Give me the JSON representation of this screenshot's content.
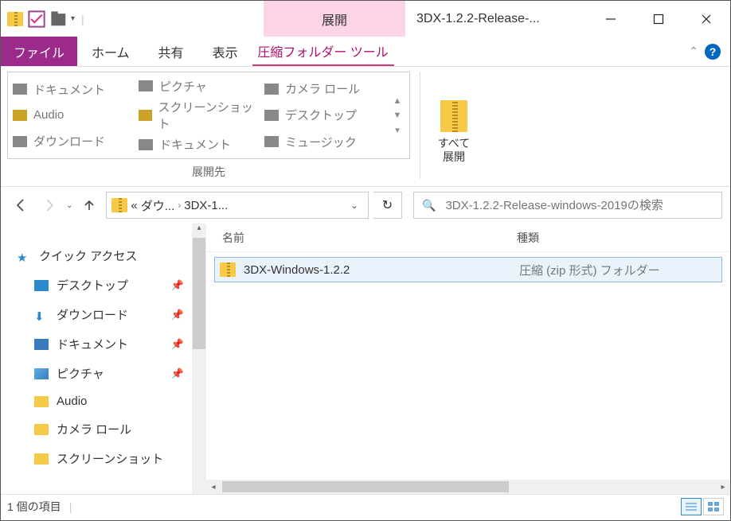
{
  "titlebar": {
    "context_label": "展開",
    "window_title": "3DX-1.2.2-Release-..."
  },
  "tabs": {
    "file": "ファイル",
    "home": "ホーム",
    "share": "共有",
    "view": "表示",
    "compressed": "圧縮フォルダー ツール"
  },
  "ribbon": {
    "destinations": [
      [
        "ドキュメント",
        "Audio",
        "ダウンロード"
      ],
      [
        "ピクチャ",
        "スクリーンショット",
        "ドキュメント"
      ],
      [
        "カメラ ロール",
        "デスクトップ",
        "ミュージック"
      ]
    ],
    "group_label": "展開先",
    "extract_all": "すべて\n展開"
  },
  "breadcrumbs": {
    "prefix": "«",
    "c1": "ダウ...",
    "c2": "3DX-1..."
  },
  "search": {
    "placeholder": "3DX-1.2.2-Release-windows-2019の検索"
  },
  "sidebar": {
    "quick": "クイック アクセス",
    "items": [
      {
        "label": "デスクトップ",
        "icon": "desk",
        "pin": true
      },
      {
        "label": "ダウンロード",
        "icon": "down",
        "pin": true
      },
      {
        "label": "ドキュメント",
        "icon": "doc",
        "pin": true
      },
      {
        "label": "ピクチャ",
        "icon": "pic",
        "pin": true
      },
      {
        "label": "Audio",
        "icon": "fold",
        "pin": false
      },
      {
        "label": "カメラ ロール",
        "icon": "fold",
        "pin": false
      },
      {
        "label": "スクリーンショット",
        "icon": "fold",
        "pin": false
      }
    ]
  },
  "columns": {
    "name": "名前",
    "type": "種類"
  },
  "files": [
    {
      "name": "3DX-Windows-1.2.2",
      "type": "圧縮 (zip 形式) フォルダー"
    }
  ],
  "status": {
    "count": "1 個の項目"
  }
}
